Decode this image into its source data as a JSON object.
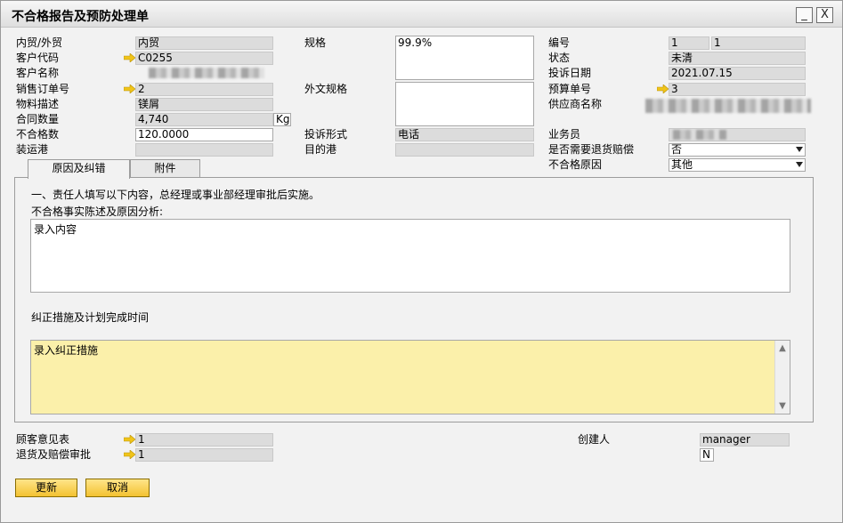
{
  "window": {
    "title": "不合格报告及预防处理单",
    "minimize": "_",
    "close": "X"
  },
  "left": {
    "trade_type_label": "内贸/外贸",
    "trade_type_value": "内贸",
    "customer_code_label": "客户代码",
    "customer_code_value": "C0255",
    "customer_name_label": "客户名称",
    "sales_order_label": "销售订单号",
    "sales_order_value": "2",
    "material_desc_label": "物料描述",
    "material_desc_value": "镁屑",
    "contract_qty_label": "合同数量",
    "contract_qty_value": "4,740",
    "contract_qty_unit": "Kg",
    "nonconform_qty_label": "不合格数",
    "nonconform_qty_value": "120.0000",
    "loading_port_label": "装运港"
  },
  "middle": {
    "spec_label": "规格",
    "spec_value": "99.9%",
    "foreign_spec_label": "外文规格",
    "complaint_form_label": "投诉形式",
    "complaint_form_value": "电话",
    "dest_port_label": "目的港"
  },
  "right": {
    "number_label": "编号",
    "number_value_a": "1",
    "number_value_b": "1",
    "status_label": "状态",
    "status_value": "未清",
    "complaint_date_label": "投诉日期",
    "complaint_date_value": "2021.07.15",
    "budget_no_label": "预算单号",
    "budget_no_value": "3",
    "supplier_label": "供应商名称",
    "salesperson_label": "业务员",
    "return_label": "是否需要退货赔偿",
    "return_value": "否",
    "reason_label": "不合格原因",
    "reason_value": "其他"
  },
  "tabs": [
    {
      "label": "原因及纠错"
    },
    {
      "label": "附件"
    }
  ],
  "panel": {
    "instruction": "一、责任人填写以下内容，总经理或事业部经理审批后实施。",
    "analysis_label": "不合格事实陈述及原因分析:",
    "analysis_value": "录入内容",
    "correction_label": "纠正措施及计划完成时间",
    "correction_value": "录入纠正措施"
  },
  "bottom": {
    "feedback_label": "顾客意见表",
    "feedback_value": "1",
    "return_approval_label": "退货及赔偿审批",
    "return_approval_value": "1",
    "creator_label": "创建人",
    "creator_value": "manager",
    "creator_flag": "N"
  },
  "buttons": {
    "update": "更新",
    "cancel": "取消"
  },
  "colors": {
    "link_arrow": "#f0c419",
    "yellow_field": "#fbf0aa",
    "button": "#f3c231"
  }
}
